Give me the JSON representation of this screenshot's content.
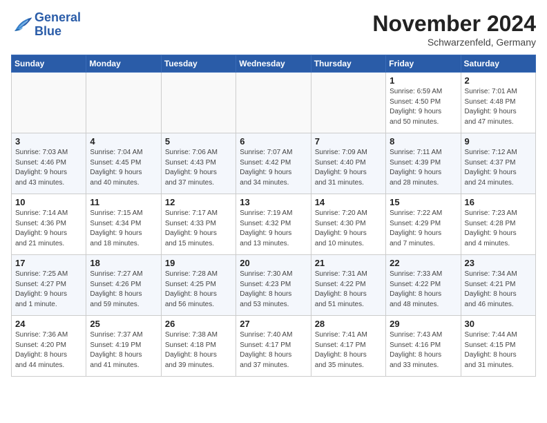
{
  "header": {
    "logo_line1": "General",
    "logo_line2": "Blue",
    "month_title": "November 2024",
    "location": "Schwarzenfeld, Germany"
  },
  "columns": [
    "Sunday",
    "Monday",
    "Tuesday",
    "Wednesday",
    "Thursday",
    "Friday",
    "Saturday"
  ],
  "weeks": [
    [
      {
        "day": "",
        "info": ""
      },
      {
        "day": "",
        "info": ""
      },
      {
        "day": "",
        "info": ""
      },
      {
        "day": "",
        "info": ""
      },
      {
        "day": "",
        "info": ""
      },
      {
        "day": "1",
        "info": "Sunrise: 6:59 AM\nSunset: 4:50 PM\nDaylight: 9 hours\nand 50 minutes."
      },
      {
        "day": "2",
        "info": "Sunrise: 7:01 AM\nSunset: 4:48 PM\nDaylight: 9 hours\nand 47 minutes."
      }
    ],
    [
      {
        "day": "3",
        "info": "Sunrise: 7:03 AM\nSunset: 4:46 PM\nDaylight: 9 hours\nand 43 minutes."
      },
      {
        "day": "4",
        "info": "Sunrise: 7:04 AM\nSunset: 4:45 PM\nDaylight: 9 hours\nand 40 minutes."
      },
      {
        "day": "5",
        "info": "Sunrise: 7:06 AM\nSunset: 4:43 PM\nDaylight: 9 hours\nand 37 minutes."
      },
      {
        "day": "6",
        "info": "Sunrise: 7:07 AM\nSunset: 4:42 PM\nDaylight: 9 hours\nand 34 minutes."
      },
      {
        "day": "7",
        "info": "Sunrise: 7:09 AM\nSunset: 4:40 PM\nDaylight: 9 hours\nand 31 minutes."
      },
      {
        "day": "8",
        "info": "Sunrise: 7:11 AM\nSunset: 4:39 PM\nDaylight: 9 hours\nand 28 minutes."
      },
      {
        "day": "9",
        "info": "Sunrise: 7:12 AM\nSunset: 4:37 PM\nDaylight: 9 hours\nand 24 minutes."
      }
    ],
    [
      {
        "day": "10",
        "info": "Sunrise: 7:14 AM\nSunset: 4:36 PM\nDaylight: 9 hours\nand 21 minutes."
      },
      {
        "day": "11",
        "info": "Sunrise: 7:15 AM\nSunset: 4:34 PM\nDaylight: 9 hours\nand 18 minutes."
      },
      {
        "day": "12",
        "info": "Sunrise: 7:17 AM\nSunset: 4:33 PM\nDaylight: 9 hours\nand 15 minutes."
      },
      {
        "day": "13",
        "info": "Sunrise: 7:19 AM\nSunset: 4:32 PM\nDaylight: 9 hours\nand 13 minutes."
      },
      {
        "day": "14",
        "info": "Sunrise: 7:20 AM\nSunset: 4:30 PM\nDaylight: 9 hours\nand 10 minutes."
      },
      {
        "day": "15",
        "info": "Sunrise: 7:22 AM\nSunset: 4:29 PM\nDaylight: 9 hours\nand 7 minutes."
      },
      {
        "day": "16",
        "info": "Sunrise: 7:23 AM\nSunset: 4:28 PM\nDaylight: 9 hours\nand 4 minutes."
      }
    ],
    [
      {
        "day": "17",
        "info": "Sunrise: 7:25 AM\nSunset: 4:27 PM\nDaylight: 9 hours\nand 1 minute."
      },
      {
        "day": "18",
        "info": "Sunrise: 7:27 AM\nSunset: 4:26 PM\nDaylight: 8 hours\nand 59 minutes."
      },
      {
        "day": "19",
        "info": "Sunrise: 7:28 AM\nSunset: 4:25 PM\nDaylight: 8 hours\nand 56 minutes."
      },
      {
        "day": "20",
        "info": "Sunrise: 7:30 AM\nSunset: 4:23 PM\nDaylight: 8 hours\nand 53 minutes."
      },
      {
        "day": "21",
        "info": "Sunrise: 7:31 AM\nSunset: 4:22 PM\nDaylight: 8 hours\nand 51 minutes."
      },
      {
        "day": "22",
        "info": "Sunrise: 7:33 AM\nSunset: 4:22 PM\nDaylight: 8 hours\nand 48 minutes."
      },
      {
        "day": "23",
        "info": "Sunrise: 7:34 AM\nSunset: 4:21 PM\nDaylight: 8 hours\nand 46 minutes."
      }
    ],
    [
      {
        "day": "24",
        "info": "Sunrise: 7:36 AM\nSunset: 4:20 PM\nDaylight: 8 hours\nand 44 minutes."
      },
      {
        "day": "25",
        "info": "Sunrise: 7:37 AM\nSunset: 4:19 PM\nDaylight: 8 hours\nand 41 minutes."
      },
      {
        "day": "26",
        "info": "Sunrise: 7:38 AM\nSunset: 4:18 PM\nDaylight: 8 hours\nand 39 minutes."
      },
      {
        "day": "27",
        "info": "Sunrise: 7:40 AM\nSunset: 4:17 PM\nDaylight: 8 hours\nand 37 minutes."
      },
      {
        "day": "28",
        "info": "Sunrise: 7:41 AM\nSunset: 4:17 PM\nDaylight: 8 hours\nand 35 minutes."
      },
      {
        "day": "29",
        "info": "Sunrise: 7:43 AM\nSunset: 4:16 PM\nDaylight: 8 hours\nand 33 minutes."
      },
      {
        "day": "30",
        "info": "Sunrise: 7:44 AM\nSunset: 4:15 PM\nDaylight: 8 hours\nand 31 minutes."
      }
    ]
  ]
}
